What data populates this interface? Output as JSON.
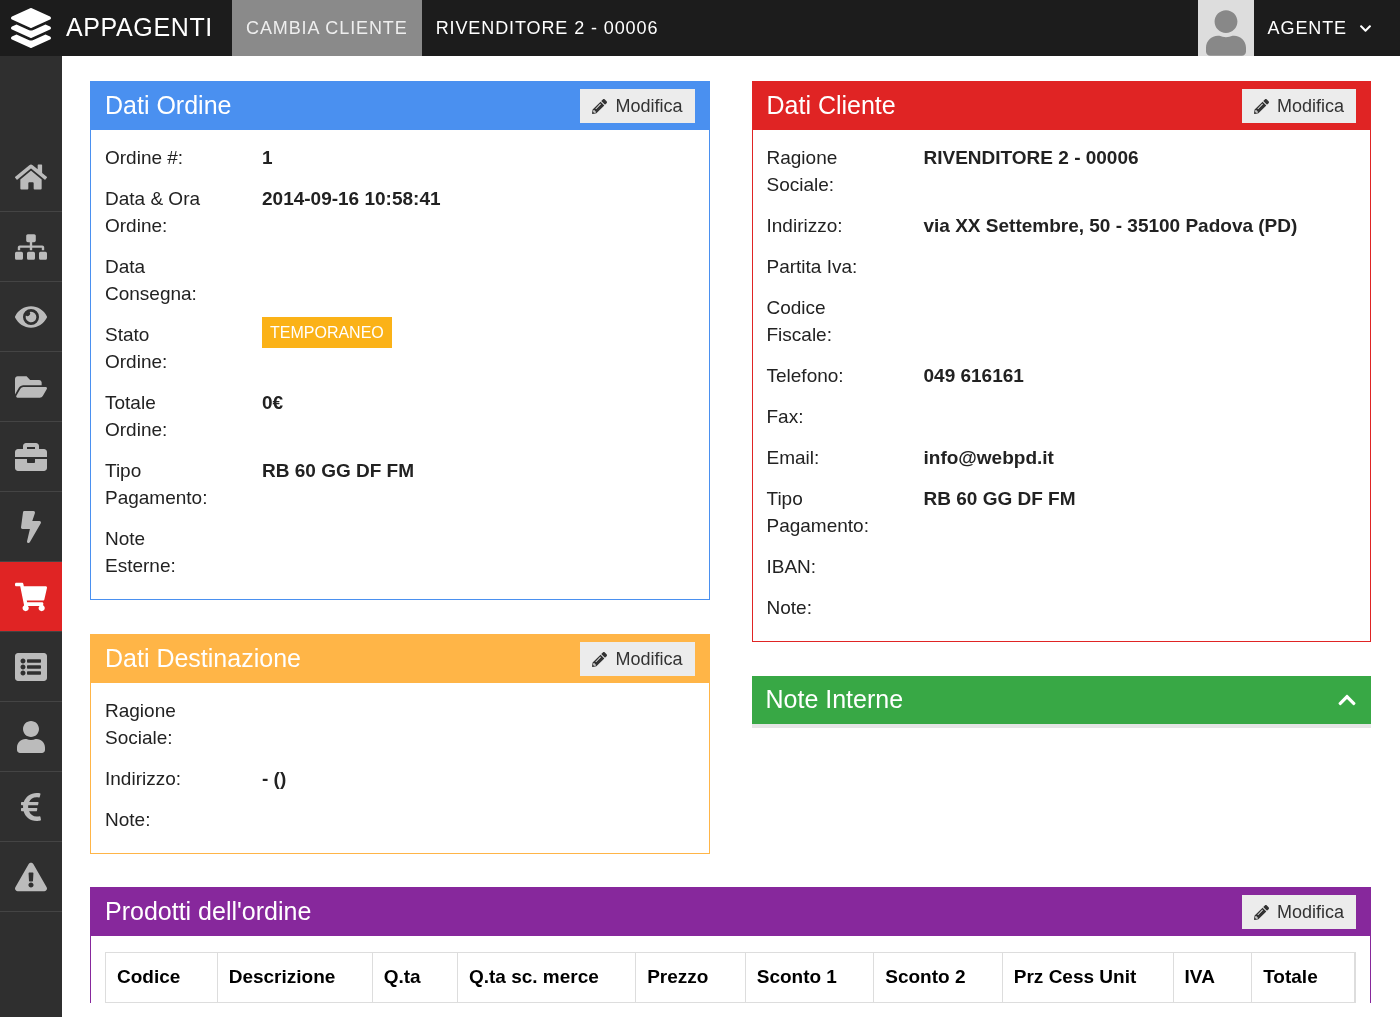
{
  "topbar": {
    "brand": "APPAGENTI",
    "nav": [
      {
        "label": "CAMBIA CLIENTE",
        "selected": true
      },
      {
        "label": "RIVENDITORE 2 - 00006",
        "selected": false
      }
    ],
    "user": "AGENTE"
  },
  "sidebar": {
    "items": [
      {
        "selected": false
      },
      {
        "selected": false
      },
      {
        "selected": false
      },
      {
        "selected": false
      },
      {
        "selected": false
      },
      {
        "selected": false
      },
      {
        "selected": true
      },
      {
        "selected": false
      },
      {
        "selected": false
      },
      {
        "selected": false
      },
      {
        "selected": false
      }
    ]
  },
  "left_cards": [
    {
      "title": "Dati Ordine",
      "color": "#4a90f0",
      "button": "Modifica",
      "fields": [
        {
          "label": "Ordine #:",
          "value": "1",
          "kind": "text"
        },
        {
          "label": "Data & Ora Ordine:",
          "value": "2014-09-16 10:58:41",
          "kind": "text"
        },
        {
          "label": "Data Consegna:"
        },
        {
          "label": "Stato Ordine:",
          "value": "TEMPORANEO",
          "kind": "badge"
        },
        {
          "label": "Totale Ordine:",
          "value": "0€",
          "kind": "text"
        },
        {
          "label": "Tipo Pagamento:",
          "value": "RB 60 GG DF FM",
          "kind": "text"
        },
        {
          "label": "Note Esterne:"
        }
      ]
    },
    {
      "title": "Dati Destinazione",
      "color": "#ffb547",
      "button": "Modifica",
      "fields": [
        {
          "label": "Ragione Sociale:"
        },
        {
          "label": "Indirizzo:",
          "value": "- ()",
          "kind": "text"
        },
        {
          "label": "Note:"
        }
      ]
    }
  ],
  "right_cards": [
    {
      "title": "Dati Cliente",
      "color": "#e02424",
      "button": "Modifica",
      "fields": [
        {
          "label": "Ragione Sociale:",
          "value": "RIVENDITORE 2 - 00006",
          "kind": "text"
        },
        {
          "label": "Indirizzo:",
          "value": "via XX Settembre, 50 - 35100 Padova (PD)",
          "kind": "text"
        },
        {
          "label": "Partita Iva:"
        },
        {
          "label": "Codice Fiscale:"
        },
        {
          "label": "Telefono:",
          "value": "049 616161",
          "kind": "text"
        },
        {
          "label": "Fax:"
        },
        {
          "label": "Email:",
          "value": "info@webpd.it",
          "kind": "text"
        },
        {
          "label": "Tipo Pagamento:",
          "value": "RB 60 GG DF FM",
          "kind": "text"
        },
        {
          "label": "IBAN:"
        },
        {
          "label": "Note:"
        }
      ]
    }
  ],
  "note_interne": {
    "title": "Note Interne",
    "color": "#38a845"
  },
  "products": {
    "title": "Prodotti dell'ordine",
    "color": "#87289c",
    "button": "Modifica",
    "columns": [
      "Codice",
      "Descrizione",
      "Q.ta",
      "Q.ta sc. merce",
      "Prezzo",
      "Sconto 1",
      "Sconto 2",
      "Prz Cess Unit",
      "IVA",
      "Totale"
    ]
  }
}
